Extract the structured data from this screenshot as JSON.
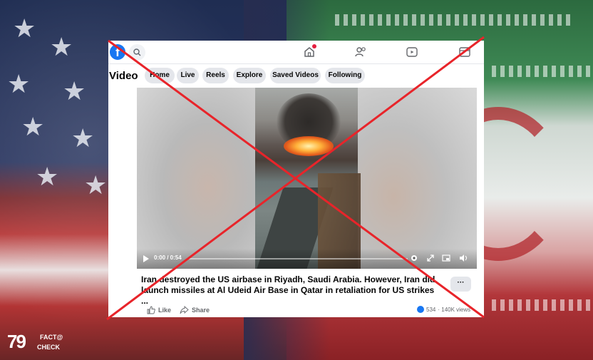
{
  "page": {
    "title": "Video"
  },
  "tabs": [
    "Home",
    "Live",
    "Reels",
    "Explore",
    "Saved Videos",
    "Following"
  ],
  "video": {
    "time_display": "0:00 / 0:54"
  },
  "post": {
    "caption": "Iran destroyed the US airbase in Riyadh, Saudi Arabia. However, Iran did launch missiles at Al Udeid Air Base in Qatar in retaliation for US strikes ...",
    "more_label": "···",
    "like_label": "Like",
    "share_label": "Share",
    "reaction_count": "534",
    "views": "· 140K views"
  },
  "watermark": {
    "line1": "FACT@",
    "line2": "CHECK",
    "mark": "79"
  },
  "colors": {
    "accent": "#1877f2",
    "debunk_x": "#e8242a",
    "notification": "#e41e3f"
  },
  "icons": [
    "facebook-icon",
    "search-icon",
    "home-icon",
    "friends-icon",
    "video-icon",
    "gaming-icon",
    "play-icon",
    "settings-icon",
    "fullscreen-icon",
    "pip-icon",
    "volume-icon",
    "like-icon",
    "share-icon"
  ]
}
